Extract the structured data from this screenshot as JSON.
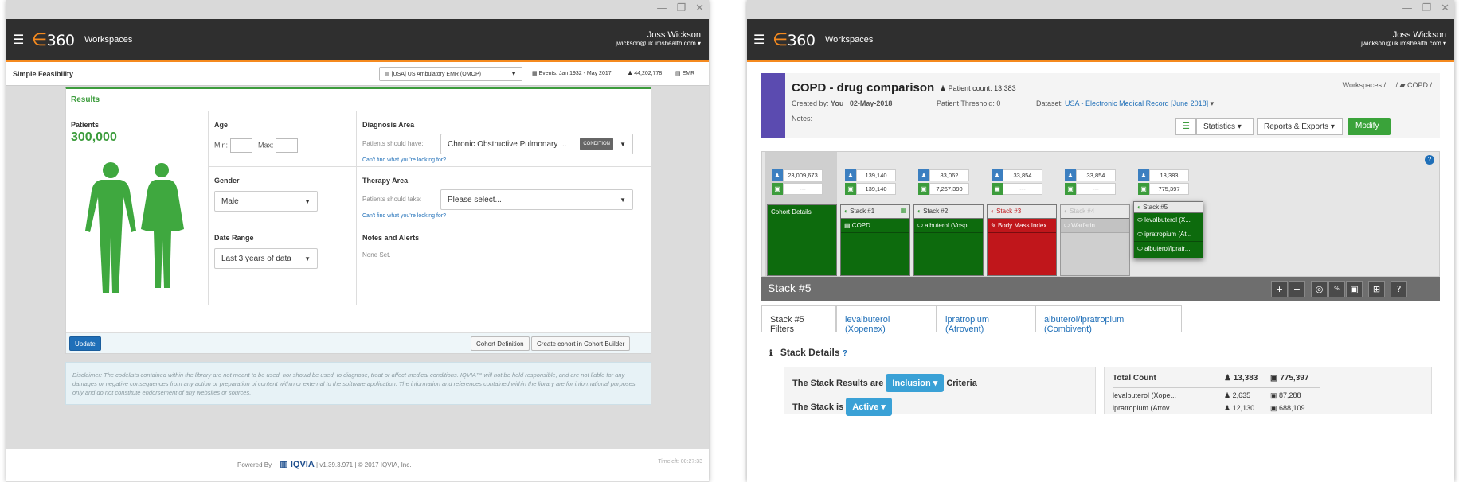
{
  "app": {
    "logo": "360",
    "workspaces": "Workspaces",
    "user_name": "Joss Wickson",
    "user_email": "jwickson@uk.imshealth.com"
  },
  "win1": {
    "page_title": "Simple Feasibility",
    "dataset": "[USA] US Ambulatory EMR (OMOP)",
    "events": "Events: Jan 1932 - May 2017",
    "patients_total": "44,202,778",
    "emr": "EMR",
    "results_title": "Results",
    "patients_label": "Patients",
    "patients_value": "300,000",
    "age_label": "Age",
    "min_label": "Min:",
    "max_label": "Max:",
    "gender_label": "Gender",
    "gender_value": "Male",
    "date_label": "Date Range",
    "date_value": "Last 3 years of data",
    "diag_label": "Diagnosis Area",
    "diag_hint": "Patients should have:",
    "diag_value": "Chronic Obstructive Pulmonary ...",
    "diag_badge": "CONDITION",
    "cant_find": "Can't find what you're looking for?",
    "therapy_label": "Therapy Area",
    "therapy_hint": "Patients should take:",
    "therapy_value": "Please select...",
    "notes_label": "Notes and Alerts",
    "notes_value": "None Set.",
    "update_btn": "Update",
    "cohort_def_btn": "Cohort Definition",
    "create_cohort_btn": "Create cohort in Cohort Builder",
    "disclaimer": "Disclaimer: The codelists contained within the library are not meant to be used, nor should be used, to diagnose, treat or affect medical conditions. IQVIA™ will not be held responsible, and are not liable for any damages or negative consequences from any action or preparation of content within or external to the software application. The information and references contained within the library are for informational purposes only and do not constitute endorsement of any websites or sources.",
    "powered_by": "Powered By",
    "iqvia": "IQVIA",
    "version": "| v1.39.3.971 | © 2017 IQVIA, Inc.",
    "timeleft": "Timeleft: 00:27:33"
  },
  "win2": {
    "title": "COPD - drug comparison",
    "patient_count": "Patient count: 13,383",
    "created_by_label": "Created by:",
    "created_by": "You",
    "created_date": "02-May-2018",
    "threshold": "Patient Threshold: 0",
    "dataset_label": "Dataset:",
    "dataset": "USA - Electronic Medical Record [June 2018]",
    "notes": "Notes:",
    "breadcrumb_ws": "Workspaces  /  ...  /",
    "breadcrumb_copd": "COPD /",
    "stats_btn": "Statistics",
    "reports_btn": "Reports & Exports",
    "modify_btn": "Modify",
    "cohort_details": "Cohort Details",
    "counts": [
      {
        "p": "23,009,673",
        "t": "---"
      },
      {
        "p": "139,140",
        "t": "139,140"
      },
      {
        "p": "83,062",
        "t": "7,267,390"
      },
      {
        "p": "33,854",
        "t": "---"
      },
      {
        "p": "33,854",
        "t": "---"
      },
      {
        "p": "13,383",
        "t": "775,397"
      }
    ],
    "stack1": "Stack #1",
    "stack1_item": "COPD",
    "stack2": "Stack #2",
    "stack2_item": "albuterol (Vosp...",
    "stack3": "Stack #3",
    "stack3_item": "Body Mass Index",
    "stack4": "Stack #4",
    "stack4_item": "Warfarin",
    "stack5": "Stack #5",
    "stack5_items": [
      "levalbuterol (X...",
      "ipratropium (At...",
      "albuterol/ipratr..."
    ],
    "stack_bar": "Stack #5",
    "tabs": [
      "Stack #5 Filters",
      "levalbuterol (Xopenex)",
      "ipratropium (Atrovent)",
      "albuterol/ipratropium (Combivent)"
    ],
    "stack_details": "Stack Details",
    "results_are": "The Stack Results are",
    "inclusion": "Inclusion",
    "criteria": "Criteria",
    "stack_is": "The Stack is",
    "active": "Active",
    "total_count": "Total Count",
    "total_p": "13,383",
    "total_t": "775,397",
    "rows": [
      {
        "name": "levalbuterol (Xope...",
        "p": "2,635",
        "t": "87,288"
      },
      {
        "name": "ipratropium (Atrov...",
        "p": "12,130",
        "t": "688,109"
      }
    ]
  },
  "colors": {
    "accent": "#f58a1f",
    "green": "#3c9c3c",
    "stack_green": "#0d6b0d",
    "red": "#c0161b",
    "purple": "#5b4bb0"
  }
}
